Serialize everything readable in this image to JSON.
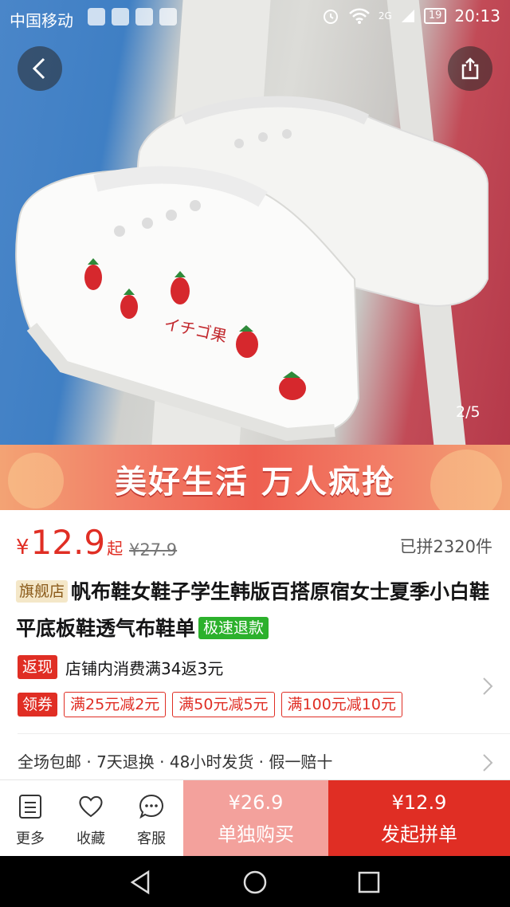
{
  "status_bar": {
    "carrier": "中国移动",
    "network": "2G",
    "battery": "19",
    "time": "20:13"
  },
  "gallery": {
    "counter": "2/5",
    "shoe_text": "イチゴ果"
  },
  "banner": {
    "text": "美好生活 万人疯抢"
  },
  "price": {
    "currency": "¥",
    "value": "12.9",
    "suffix": "起",
    "original": "¥27.9",
    "sold": "已拼2320件"
  },
  "product": {
    "flagship_tag": "旗舰店",
    "title": "帆布鞋女鞋子学生韩版百搭原宿女士夏季小白鞋平底板鞋透气布鞋单",
    "refund_tag": "极速退款"
  },
  "promo": {
    "rebate_tag": "返现",
    "rebate_text": "店铺内消费满34返3元",
    "coupon_tag": "领券",
    "coupons": [
      "满25元减2元",
      "满50元减5元",
      "满100元减10元"
    ]
  },
  "service": {
    "text": "全场包邮 · 7天退换 · 48小时发货 · 假一赔十"
  },
  "actions": {
    "more": "更多",
    "favorite": "收藏",
    "service": "客服",
    "single_price": "¥26.9",
    "single_label": "单独购买",
    "group_price": "¥12.9",
    "group_label": "发起拼单"
  },
  "colors": {
    "accent": "#e02e24",
    "single_button": "#f3a19c",
    "refund_green": "#2cb12c"
  }
}
